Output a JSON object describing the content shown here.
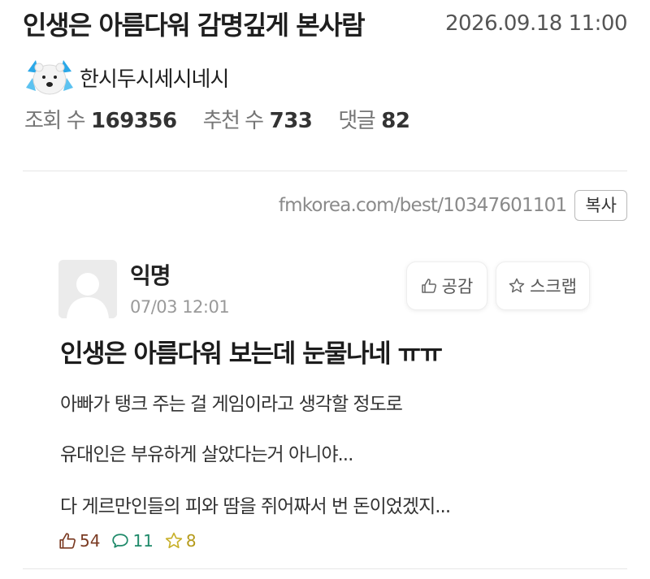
{
  "post": {
    "title": "인생은 아름다워 감명깊게 본사람",
    "datetime": "2026.09.18 11:00",
    "author": "한시두시세시네시",
    "stats": {
      "views_label": "조회 수",
      "views_value": "169356",
      "recommend_label": "추천 수",
      "recommend_value": "733",
      "comments_label": "댓글",
      "comments_value": "82"
    },
    "url": "fmkorea.com/best/10347601101",
    "copy_label": "복사"
  },
  "comment": {
    "author": "익명",
    "date": "07/03 12:01",
    "like_button_label": "공감",
    "scrap_button_label": "스크랩",
    "title": "인생은 아름다워 보는데 눈물나네 ㅠㅠ",
    "lines": [
      "아빠가 탱크 주는 걸 게임이라고 생각할 정도로",
      "유대인은 부유하게 살았다는거 아니야...",
      "다 게르만인들의 피와 땀을 쥐어짜서 번 돈이었겠지..."
    ],
    "reactions": {
      "likes": "54",
      "replies": "11",
      "stars": "8"
    }
  },
  "icons": {
    "author_avatar": "polar-bear-avatar-icon",
    "comment_avatar": "default-user-avatar-icon",
    "like": "thumbs-up-icon",
    "scrap": "star-icon",
    "reply": "speech-bubble-icon"
  },
  "colors": {
    "like_reaction": "#7a3a22",
    "reply_reaction": "#1f8a6a",
    "star_reaction": "#b59a1a"
  }
}
